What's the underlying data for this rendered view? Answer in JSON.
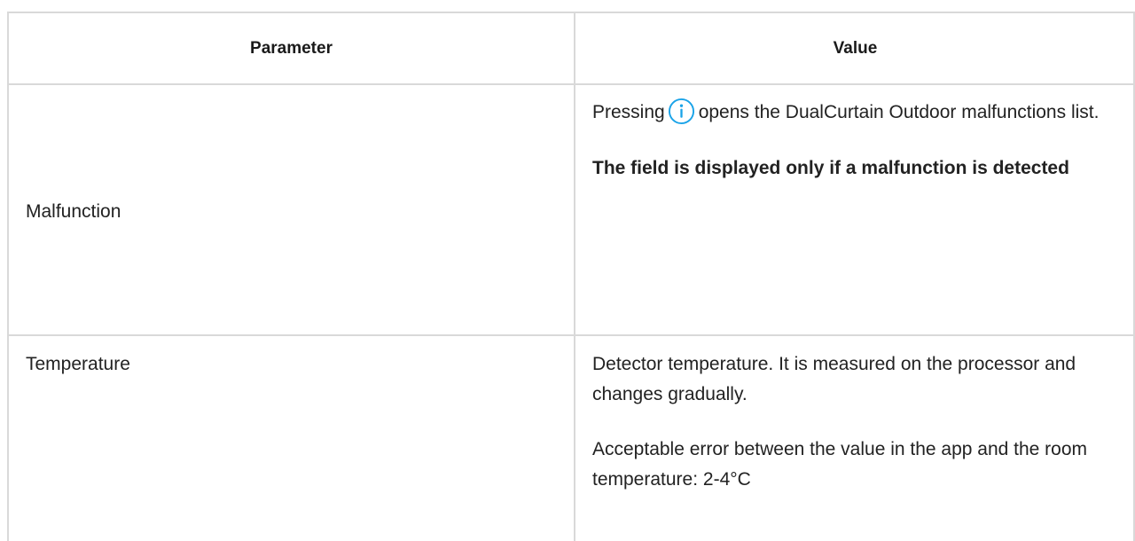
{
  "table": {
    "headers": {
      "parameter": "Parameter",
      "value": "Value"
    },
    "rows": [
      {
        "parameter": "Malfunction",
        "value_line1_before_icon": "Pressing",
        "value_icon": "info-icon",
        "value_line1_after_icon": "opens the DualCurtain Outdoor malfunctions list.",
        "value_note": "The field is displayed only if a malfunction is detected"
      },
      {
        "parameter": "Temperature",
        "value_paragraph1": "Detector temperature. It is measured on the processor and changes gradually.",
        "value_paragraph2": "Acceptable error between the value in the app and the room temperature: 2-4°C"
      }
    ]
  },
  "colors": {
    "border": "#d9d9d9",
    "text": "#222222",
    "icon_accent": "#1aa3e8"
  }
}
